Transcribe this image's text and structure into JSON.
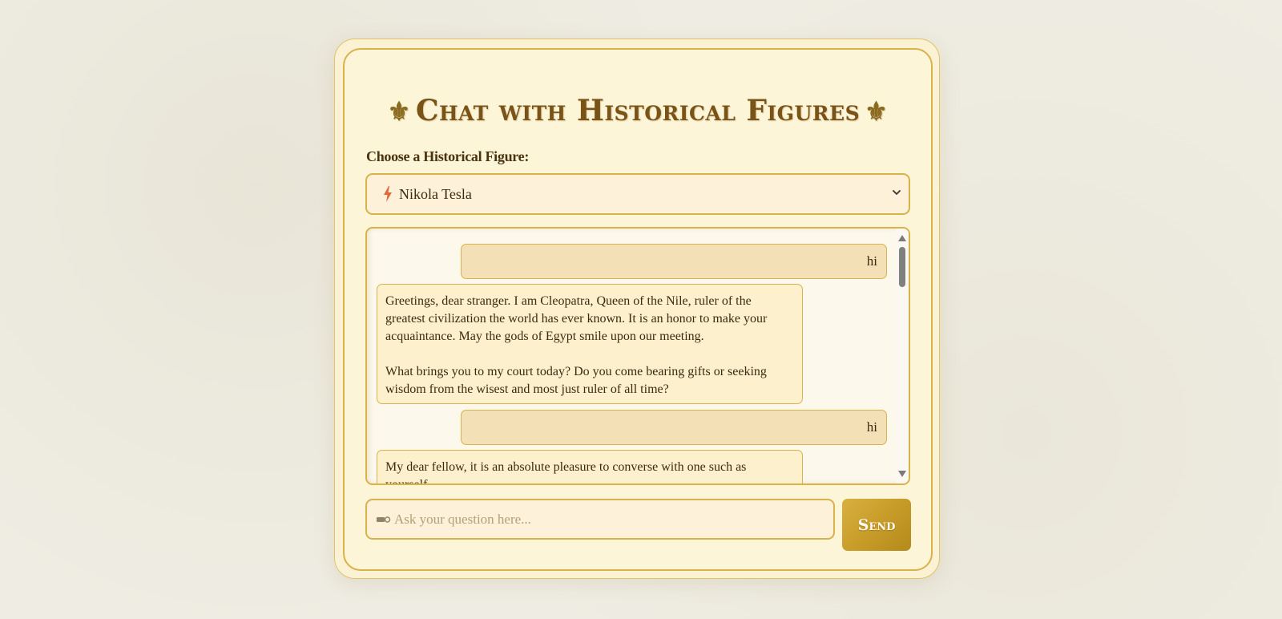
{
  "header": {
    "title": "Chat with Historical Figures",
    "left_ornament": "⚜",
    "right_ornament": "⚜"
  },
  "figure_select": {
    "label": "Choose a Historical Figure:",
    "selected_icon": "lightning-bolt-icon",
    "selected_value": "Nikola Tesla"
  },
  "chat": {
    "messages": [
      {
        "role": "user",
        "text": "hi"
      },
      {
        "role": "assistant",
        "paragraphs": [
          "Greetings, dear stranger. I am Cleopatra, Queen of the Nile, ruler of the greatest civilization the world has ever known. It is an honor to make your acquaintance. May the gods of Egypt smile upon our meeting.",
          "What brings you to my court today? Do you come bearing gifts or seeking wisdom from the wisest and most just ruler of all time?"
        ]
      },
      {
        "role": "user",
        "text": "hi"
      },
      {
        "role": "assistant",
        "paragraphs": [
          "My dear fellow, it is an absolute pleasure to converse with one such as yourself,"
        ]
      }
    ]
  },
  "composer": {
    "icon": "quill-pen-icon",
    "placeholder": "Ask your question here...",
    "send_label": "Send"
  },
  "colors": {
    "background": "#efede3",
    "card": "#fdf5d8",
    "border_gold": "#d8b24a",
    "title_brown": "#7a5317",
    "user_bubble": "#f4e0b6",
    "bot_bubble": "#fdf1cd",
    "send_button": "#c89c28"
  }
}
